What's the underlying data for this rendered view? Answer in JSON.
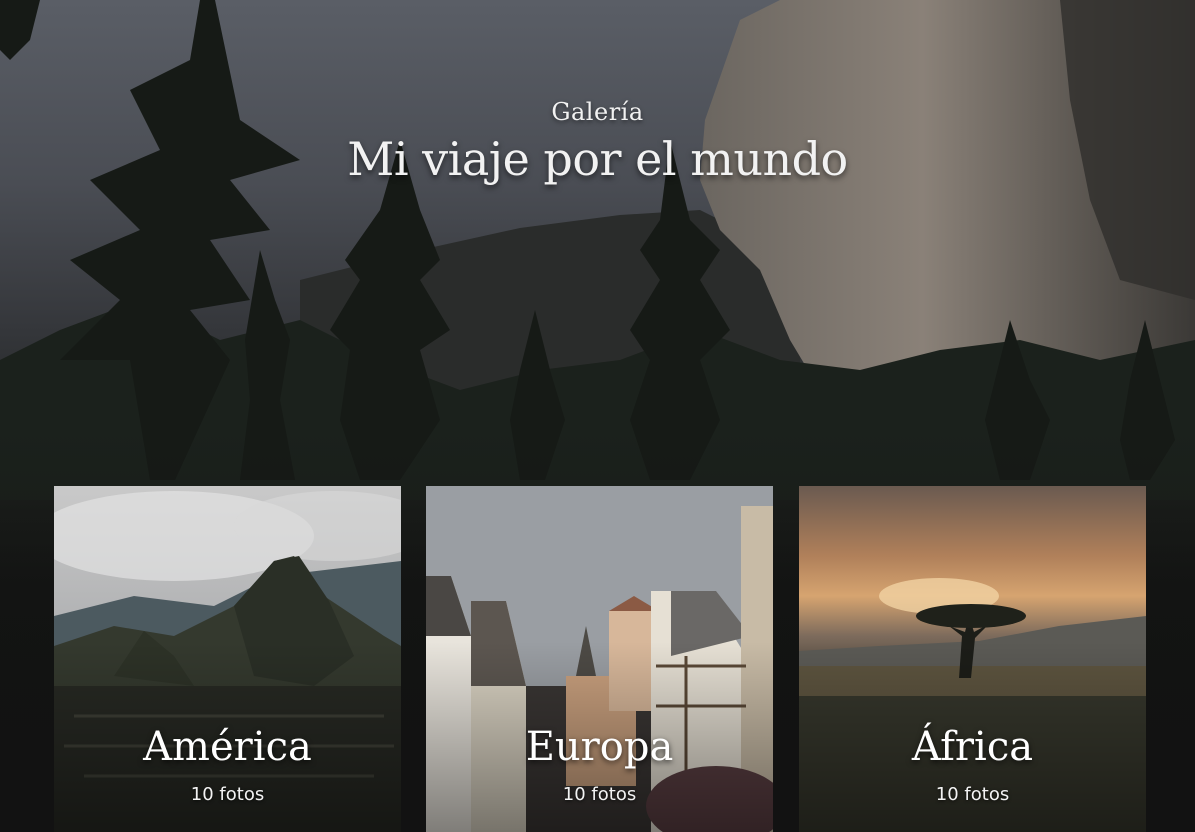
{
  "hero": {
    "subtitle": "Galería",
    "title": "Mi viaje por el mundo"
  },
  "gallery": [
    {
      "name": "América",
      "count": "10 fotos"
    },
    {
      "name": "Europa",
      "count": "10 fotos"
    },
    {
      "name": "África",
      "count": "10 fotos"
    }
  ]
}
